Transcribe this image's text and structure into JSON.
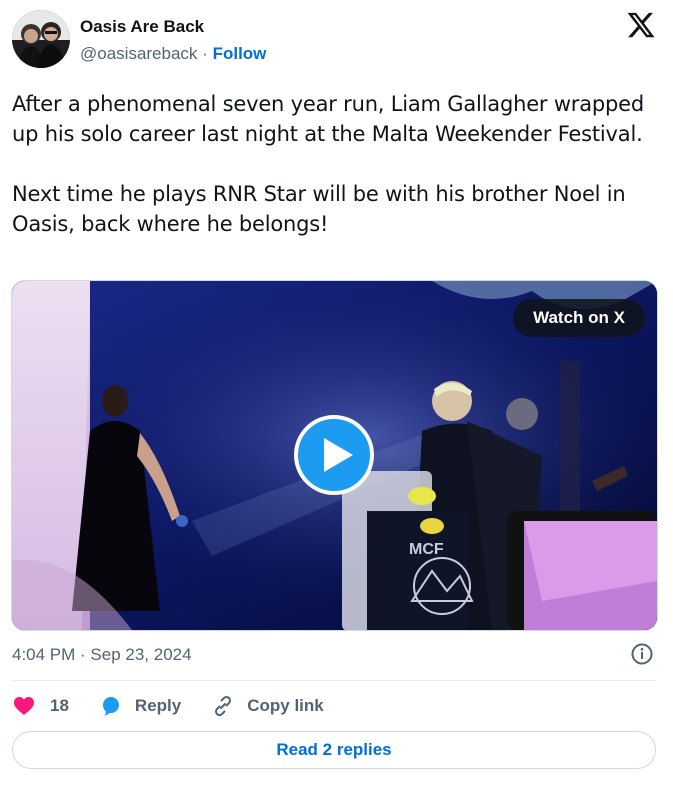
{
  "author": {
    "name": "Oasis Are Back",
    "handle": "@oasisareback",
    "separator": "·",
    "follow_label": "Follow"
  },
  "tweet": {
    "text": "After a phenomenal seven year run, Liam Gallagher wrapped up his solo career last night at the Malta Weekender Festival.\n\nNext time he plays RNR Star will be with his brother Noel in Oasis, back where he belongs!"
  },
  "media": {
    "watch_label": "Watch on X",
    "stage_sign": "MCF"
  },
  "meta": {
    "timestamp": "4:04 PM · Sep 23, 2024"
  },
  "actions": {
    "like_count": "18",
    "reply_label": "Reply",
    "copy_label": "Copy link"
  },
  "footer": {
    "read_replies_label": "Read 2 replies"
  },
  "colors": {
    "accent": "#1d9bf0",
    "link": "#006fd6",
    "like": "#f91880"
  }
}
